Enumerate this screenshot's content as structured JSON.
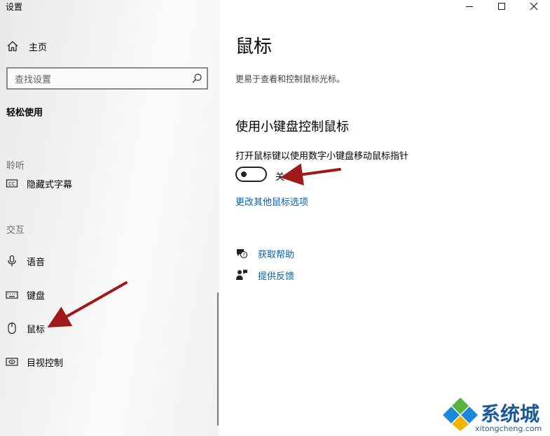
{
  "app": {
    "title": "设置"
  },
  "sidebar": {
    "home": {
      "label": "主页",
      "icon": "home-icon"
    },
    "search": {
      "placeholder": "查找设置",
      "icon": "search-icon"
    },
    "section_title": "轻松使用",
    "groups": [
      {
        "label": "聆听",
        "items": [
          {
            "label": "隐藏式字幕",
            "icon": "closed-captions-icon"
          }
        ]
      },
      {
        "label": "交互",
        "items": [
          {
            "label": "语音",
            "icon": "microphone-icon"
          },
          {
            "label": "键盘",
            "icon": "keyboard-icon"
          },
          {
            "label": "鼠标",
            "icon": "mouse-icon"
          },
          {
            "label": "目视控制",
            "icon": "eye-control-icon"
          }
        ]
      }
    ]
  },
  "window_controls": [
    "minimize",
    "maximize",
    "close"
  ],
  "main": {
    "title": "鼠标",
    "description": "更易于查看和控制鼠标光标。",
    "section_title": "使用小键盘控制鼠标",
    "setting_desc": "打开鼠标键以使用数字小键盘移动鼠标指针",
    "toggle_state": "关",
    "toggle_on": false,
    "link": "更改其他鼠标选项",
    "help": [
      {
        "label": "获取帮助",
        "icon": "help-chat-icon"
      },
      {
        "label": "提供反馈",
        "icon": "feedback-icon"
      }
    ]
  },
  "annotation_color": "#a01818",
  "watermark": {
    "brand": "系统城",
    "url": "xitongcheng.com"
  }
}
